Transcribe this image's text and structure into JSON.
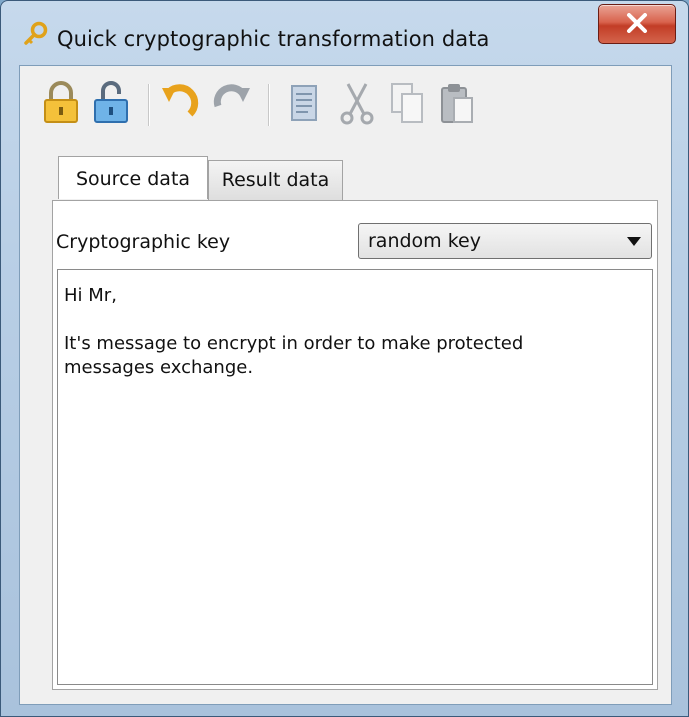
{
  "window": {
    "title": "Quick cryptographic transformation data",
    "close_symbol": "x"
  },
  "toolbar": {
    "buttons": [
      {
        "icon": "lock-closed-icon",
        "name": "encrypt"
      },
      {
        "icon": "lock-open-icon",
        "name": "decrypt"
      },
      {
        "icon": "undo-icon",
        "name": "undo"
      },
      {
        "icon": "redo-icon",
        "name": "redo"
      },
      {
        "icon": "document-icon",
        "name": "select-all"
      },
      {
        "icon": "cut-icon",
        "name": "cut"
      },
      {
        "icon": "copy-icon",
        "name": "copy"
      },
      {
        "icon": "paste-icon",
        "name": "paste"
      }
    ]
  },
  "tabs": [
    {
      "label": "Source data",
      "active": true
    },
    {
      "label": "Result data",
      "active": false
    }
  ],
  "key": {
    "label": "Cryptographic key",
    "selected": "random key"
  },
  "message": {
    "line1": "Hi Mr,",
    "line2": "It's message to encrypt in order to make protected",
    "line3": "messages exchange."
  },
  "colors": {
    "accent_gold": "#f2b632",
    "accent_blue": "#4a90d9",
    "close_red": "#c23d26"
  }
}
